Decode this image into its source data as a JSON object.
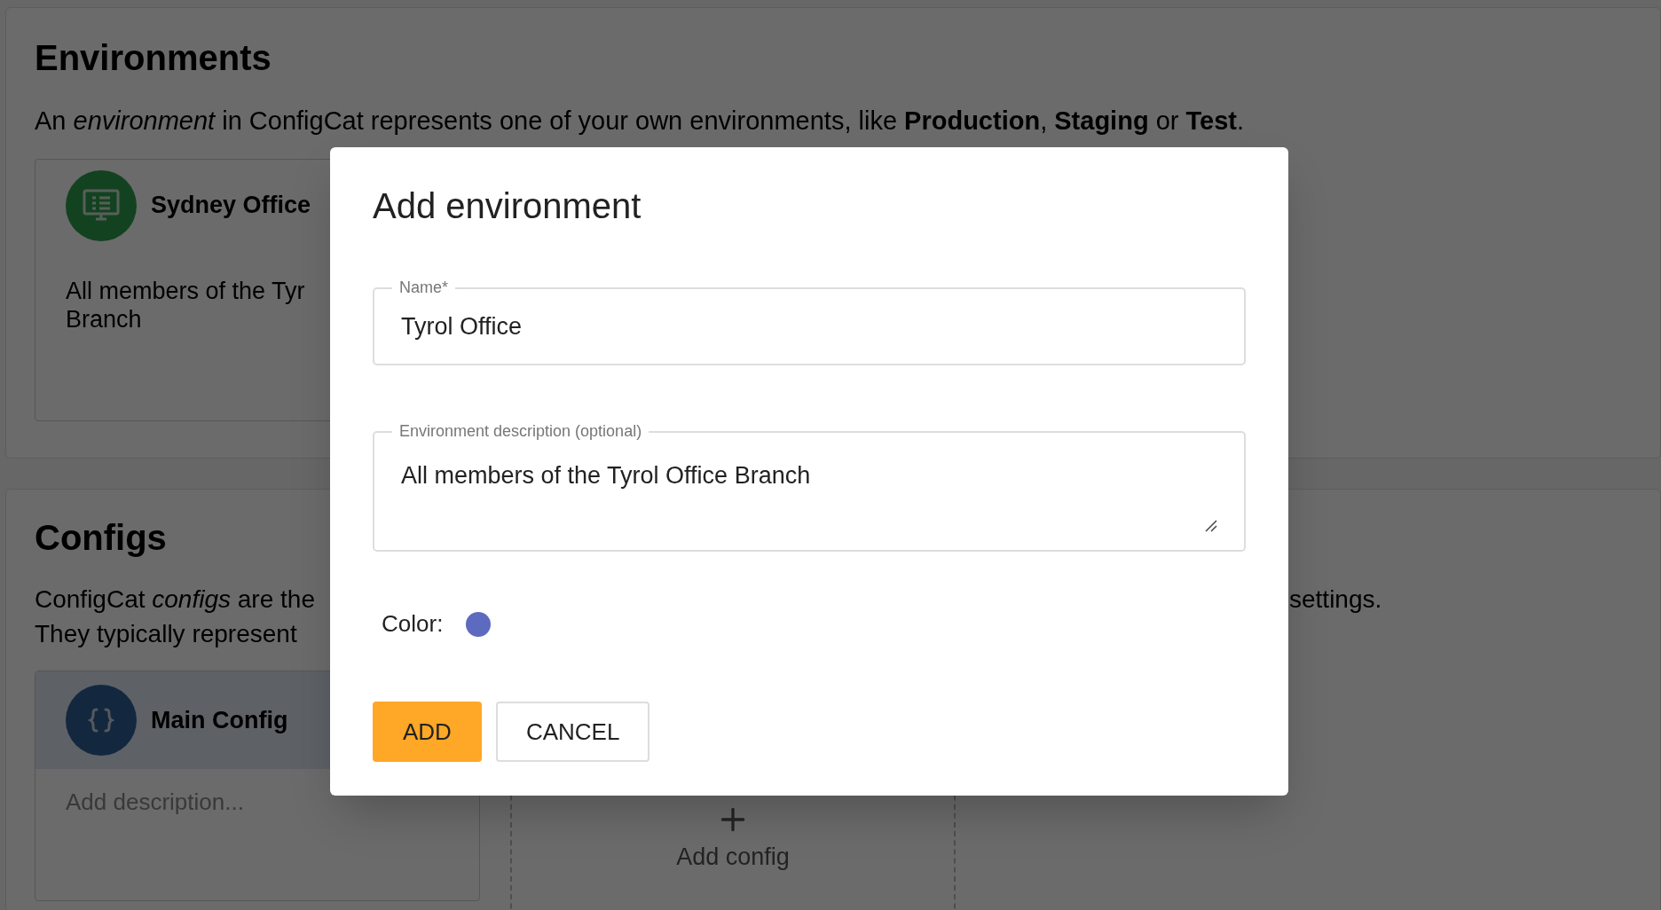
{
  "environments": {
    "title": "Environments",
    "description": "An *environment* in ConfigCat represents one of your own environments, like **Production**, **Staging** or **Test**.",
    "cards": [
      {
        "name": "Sydney Office",
        "description_lines": [
          "All members of the Tyr",
          "Branch"
        ]
      }
    ]
  },
  "configs": {
    "title": "Configs",
    "description_left": [
      "ConfigCat *configs* are the",
      "They typically represent"
    ],
    "description_right": "settings.",
    "cards": [
      {
        "name": "Main Config",
        "description_placeholder": "Add description..."
      }
    ],
    "add_label": "Add config"
  },
  "dialog": {
    "title": "Add environment",
    "name_field": {
      "label": "Name*",
      "value": "Tyrol Office"
    },
    "description_field": {
      "label": "Environment description (optional)",
      "value": "All members of the Tyrol Office Branch"
    },
    "color_picker": {
      "label": "Color:",
      "color": "#5c6bc0"
    },
    "buttons": [
      {
        "label": "ADD",
        "kind": "primary"
      },
      {
        "label": "CANCEL",
        "kind": "secondary"
      }
    ]
  }
}
